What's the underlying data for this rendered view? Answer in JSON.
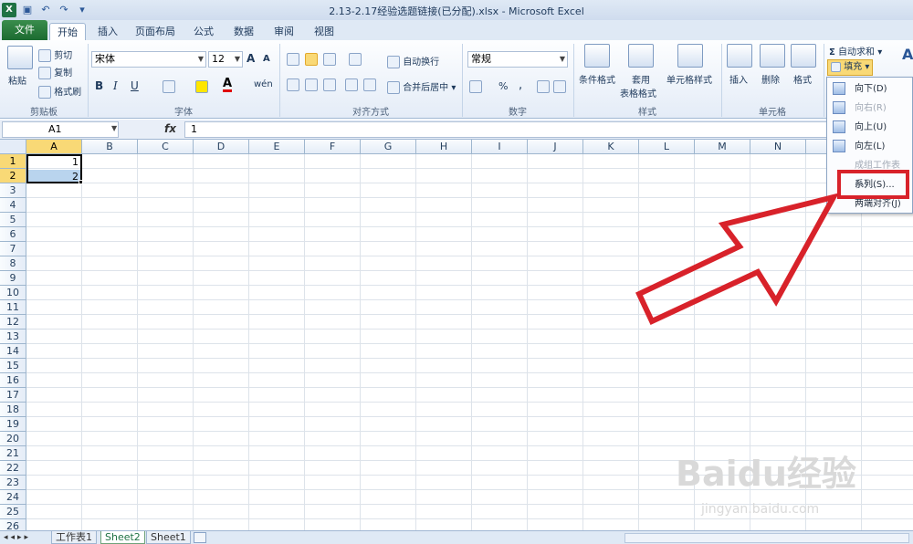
{
  "window": {
    "title": "2.13-2.17经验选题链接(已分配).xlsx - Microsoft Excel"
  },
  "qat": {
    "logo": "X",
    "save": "▣",
    "undo": "↶",
    "redo": "↷",
    "customize": "▾"
  },
  "tabs": [
    {
      "label": "文件"
    },
    {
      "label": "开始"
    },
    {
      "label": "插入"
    },
    {
      "label": "页面布局"
    },
    {
      "label": "公式"
    },
    {
      "label": "数据"
    },
    {
      "label": "审阅"
    },
    {
      "label": "视图"
    }
  ],
  "ribbon": {
    "clipboard": {
      "paste": "粘贴",
      "cut": "剪切",
      "copy": "复制",
      "format_painter": "格式刷",
      "label": "剪贴板"
    },
    "font": {
      "name": "宋体",
      "size": "12",
      "bold": "B",
      "italic": "I",
      "underline": "U",
      "grow": "A",
      "shrink": "A",
      "phonetic": "wén",
      "label": "字体"
    },
    "alignment": {
      "wrap": "自动换行",
      "merge": "合并后居中",
      "label": "对齐方式"
    },
    "number": {
      "format": "常规",
      "percent": "%",
      "comma": ",",
      "label": "数字"
    },
    "styles": {
      "conditional": "条件格式",
      "table_1": "套用",
      "table_2": "表格格式",
      "cell": "单元格样式",
      "label": "样式"
    },
    "cells": {
      "insert": "插入",
      "delete": "删除",
      "format": "格式",
      "label": "单元格"
    },
    "editing": {
      "autosum_symbol": "Σ",
      "autosum": "自动求和",
      "fill": "填充"
    }
  },
  "formula_bar": {
    "name_box": "A1",
    "fx": "fx",
    "value": "1"
  },
  "sheet": {
    "columns": [
      "A",
      "B",
      "C",
      "D",
      "E",
      "F",
      "G",
      "H",
      "I",
      "J",
      "K",
      "L",
      "M",
      "N"
    ],
    "rows": [
      "1",
      "2",
      "3",
      "4",
      "5",
      "6",
      "7",
      "8",
      "9",
      "10",
      "11",
      "12",
      "13",
      "14",
      "15",
      "16",
      "17",
      "18",
      "19",
      "20",
      "21",
      "22",
      "23",
      "24",
      "25",
      "26"
    ],
    "cells": {
      "A1": "1",
      "A2": "2"
    }
  },
  "sheet_tabs": [
    "工作表1",
    "Sheet2",
    "Sheet1"
  ],
  "fill_menu": {
    "items": [
      {
        "label": "向下(D)",
        "enabled": true
      },
      {
        "label": "向右(R)",
        "enabled": false
      },
      {
        "label": "向上(U)",
        "enabled": true
      },
      {
        "label": "向左(L)",
        "enabled": true
      },
      {
        "label": "成组工作表(A)...",
        "enabled": false
      },
      {
        "label": "系列(S)...",
        "enabled": true
      },
      {
        "label": "两端对齐(J)",
        "enabled": true
      }
    ]
  },
  "watermark": {
    "text": "Baidu经验",
    "sub": "jingyan.baidu.com"
  },
  "colors": {
    "annotation": "#d8222a",
    "selected_header": "#f9d976",
    "file_tab": "#1f7244"
  }
}
